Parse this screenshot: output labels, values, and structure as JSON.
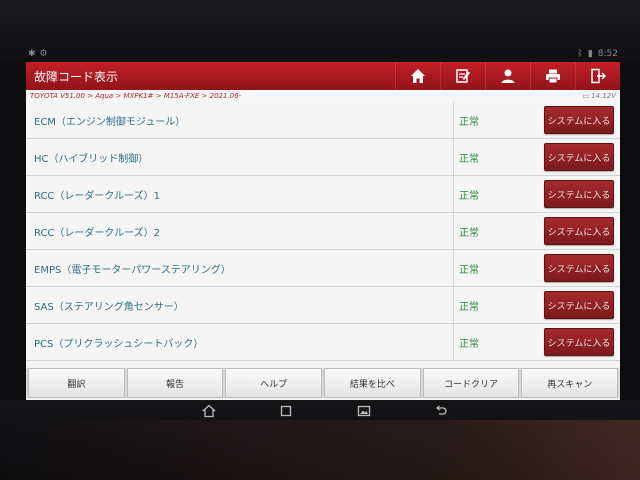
{
  "header": {
    "title": "故障コード表示",
    "icons": [
      "home-icon",
      "report-edit-icon",
      "user-icon",
      "printer-icon",
      "exit-icon"
    ]
  },
  "breadcrumb": "TOYOTA V51.00 > Aqua > MXPK1# > M15A-FXE > 2021.06-",
  "voltage": "14.12V",
  "status_bar": {
    "time": "8:52"
  },
  "systems": [
    {
      "name": "ECM（エンジン制御モジュール）",
      "status": "正常",
      "button": "システムに入る"
    },
    {
      "name": "HC（ハイブリッド制御）",
      "status": "正常",
      "button": "システムに入る"
    },
    {
      "name": "RCC（レーダークルーズ）1",
      "status": "正常",
      "button": "システムに入る"
    },
    {
      "name": "RCC（レーダークルーズ）2",
      "status": "正常",
      "button": "システムに入る"
    },
    {
      "name": "EMPS（電子モーターパワーステアリング）",
      "status": "正常",
      "button": "システムに入る"
    },
    {
      "name": "SAS（ステアリング角センサー）",
      "status": "正常",
      "button": "システムに入る"
    },
    {
      "name": "PCS（プリクラッシュシートバック）",
      "status": "正常",
      "button": "システムに入る"
    }
  ],
  "bottom_buttons": [
    "翻訳",
    "報告",
    "ヘルプ",
    "結果を比べ",
    "コードクリア",
    "再スキャン"
  ],
  "colors": {
    "header": "#b81c22",
    "system_name": "#2e6e8a",
    "status_ok": "#2d8b38",
    "enter_button": "#8f2022"
  }
}
